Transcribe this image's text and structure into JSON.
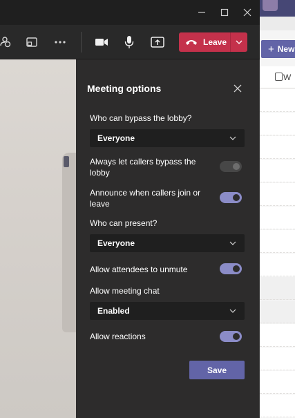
{
  "background_app": {
    "new_button_label": "New",
    "header_row_label": "W"
  },
  "toolbar": {
    "leave_label": "Leave"
  },
  "panel": {
    "title": "Meeting options",
    "bypass_lobby": {
      "label": "Who can bypass the lobby?",
      "value": "Everyone"
    },
    "callers_bypass": {
      "label": "Always let callers bypass the lobby",
      "enabled": false
    },
    "announce_callers": {
      "label": "Announce when callers join or leave",
      "enabled": true
    },
    "who_can_present": {
      "label": "Who can present?",
      "value": "Everyone"
    },
    "attendees_unmute": {
      "label": "Allow attendees to unmute",
      "enabled": true
    },
    "meeting_chat": {
      "label": "Allow meeting chat",
      "value": "Enabled"
    },
    "reactions": {
      "label": "Allow reactions",
      "enabled": true
    },
    "save_label": "Save"
  },
  "colors": {
    "accent": "#6264a7",
    "leave_red": "#c4314b",
    "toggle_on": "#8b8cc7"
  }
}
